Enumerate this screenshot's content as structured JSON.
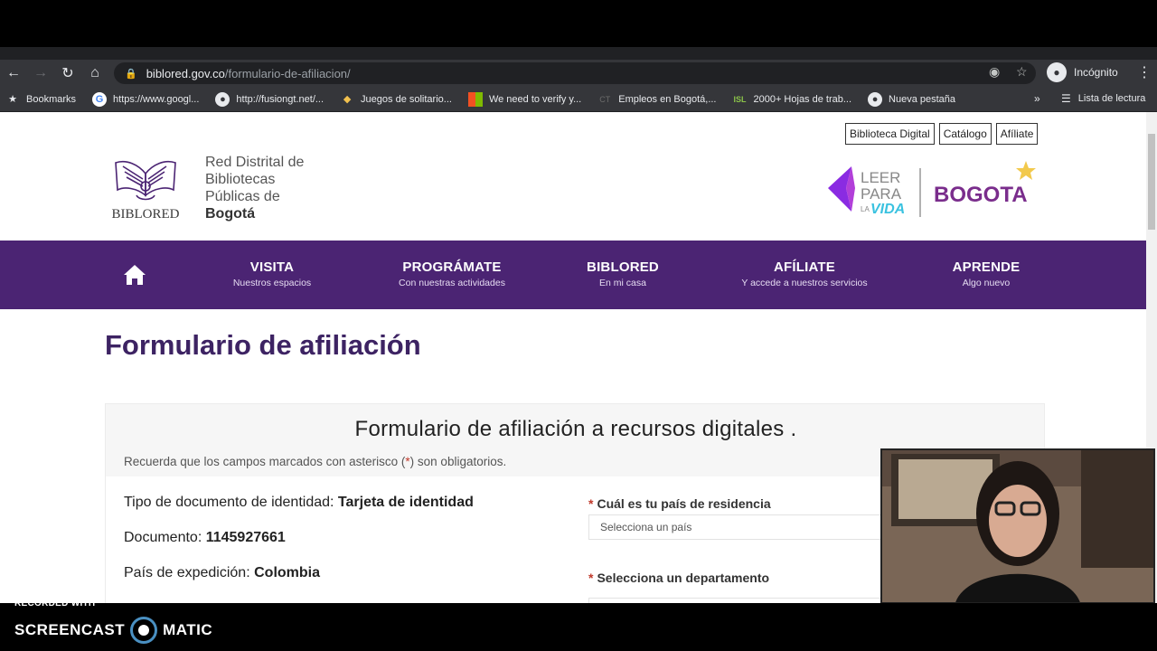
{
  "browser": {
    "url_host": "biblored.gov.co",
    "url_path": "/formulario-de-afiliacion/",
    "profile_label": "Incógnito",
    "bookmarks": [
      {
        "label": "Bookmarks",
        "icon": "star-icon"
      },
      {
        "label": "https://www.googl...",
        "icon": "google-icon"
      },
      {
        "label": "http://fusiongt.net/...",
        "icon": "globe-icon"
      },
      {
        "label": "Juegos de solitario...",
        "icon": "cards-icon"
      },
      {
        "label": "We need to verify y...",
        "icon": "microsoft-icon"
      },
      {
        "label": "Empleos en Bogotá,...",
        "icon": "ct-icon"
      },
      {
        "label": "2000+ Hojas de trab...",
        "icon": "isl-icon"
      },
      {
        "label": "Nueva pestaña",
        "icon": "globe-icon"
      }
    ],
    "more_bookmarks": "»",
    "reading_list": "Lista de lectura"
  },
  "site": {
    "util_links": [
      "Biblioteca Digital",
      "Catálogo",
      "Afíliate"
    ],
    "logo_wordmark": "BIBLORED",
    "logo_lines": [
      "Red Distrital de",
      "Bibliotecas",
      "Públicas de"
    ],
    "logo_city": "Bogotá",
    "gov_logo": {
      "leer": "LEER",
      "para": "PARA",
      "la": "LA",
      "vida": "VIDA",
      "city": "BOGOTA"
    },
    "nav": [
      {
        "title": "VISITA",
        "subtitle": "Nuestros espacios"
      },
      {
        "title": "PROGRÁMATE",
        "subtitle": "Con nuestras actividades"
      },
      {
        "title": "BIBLORED",
        "subtitle": "En mi casa"
      },
      {
        "title": "AFÍLIATE",
        "subtitle": "Y accede a nuestros servicios"
      },
      {
        "title": "APRENDE",
        "subtitle": "Algo nuevo"
      }
    ]
  },
  "main": {
    "page_title": "Formulario de afiliación",
    "form_title": "Formulario de afiliación a recursos digitales .",
    "note_before": "Recuerda que los campos marcados con asterisco (",
    "note_star": "*",
    "note_after": ") son obligatorios.",
    "info": [
      {
        "label": "Tipo de documento de identidad:",
        "value": "Tarjeta de identidad"
      },
      {
        "label": "Documento:",
        "value": "1145927661"
      },
      {
        "label": "País de expedición:",
        "value": "Colombia"
      }
    ],
    "fields": [
      {
        "label": "Cuál es tu país de residencia",
        "placeholder": "Selecciona un país"
      },
      {
        "label": "Selecciona un departamento"
      }
    ],
    "required_mark": "*"
  },
  "recording": {
    "recorded_with": "RECORDED WITH",
    "brand_left": "SCREENCAST",
    "brand_right": "MATIC"
  },
  "colors": {
    "nav_purple": "#4b2473",
    "title_purple": "#3d2363",
    "required_red": "#c0392b"
  }
}
